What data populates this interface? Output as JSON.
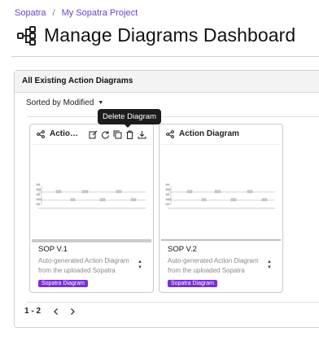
{
  "breadcrumb": {
    "items": [
      "Sopatra",
      "My Sopatra Project"
    ],
    "separator": "/"
  },
  "page": {
    "title": "Manage Diagrams Dashboard"
  },
  "panel": {
    "heading": "All Existing Action Diagrams",
    "sort_label": "Sorted by Modified"
  },
  "tooltip": {
    "text": "Delete Diagram"
  },
  "cards": [
    {
      "title": "Action Diagram",
      "title_visible": "Actio…",
      "name": "SOP V.1",
      "description": "Auto-generated Action Diagram from the uploaded Sopatra",
      "tag": "Sopatra Diagram"
    },
    {
      "title": "Action Diagram",
      "name": "SOP V.2",
      "description": "Auto-generated Action Diagram from the uploaded Sopatra",
      "tag": "Sopatra Diagram"
    }
  ],
  "pagination": {
    "range": "1 - 2"
  },
  "colors": {
    "accent": "#7b2dde",
    "link": "#6b3fd4"
  }
}
